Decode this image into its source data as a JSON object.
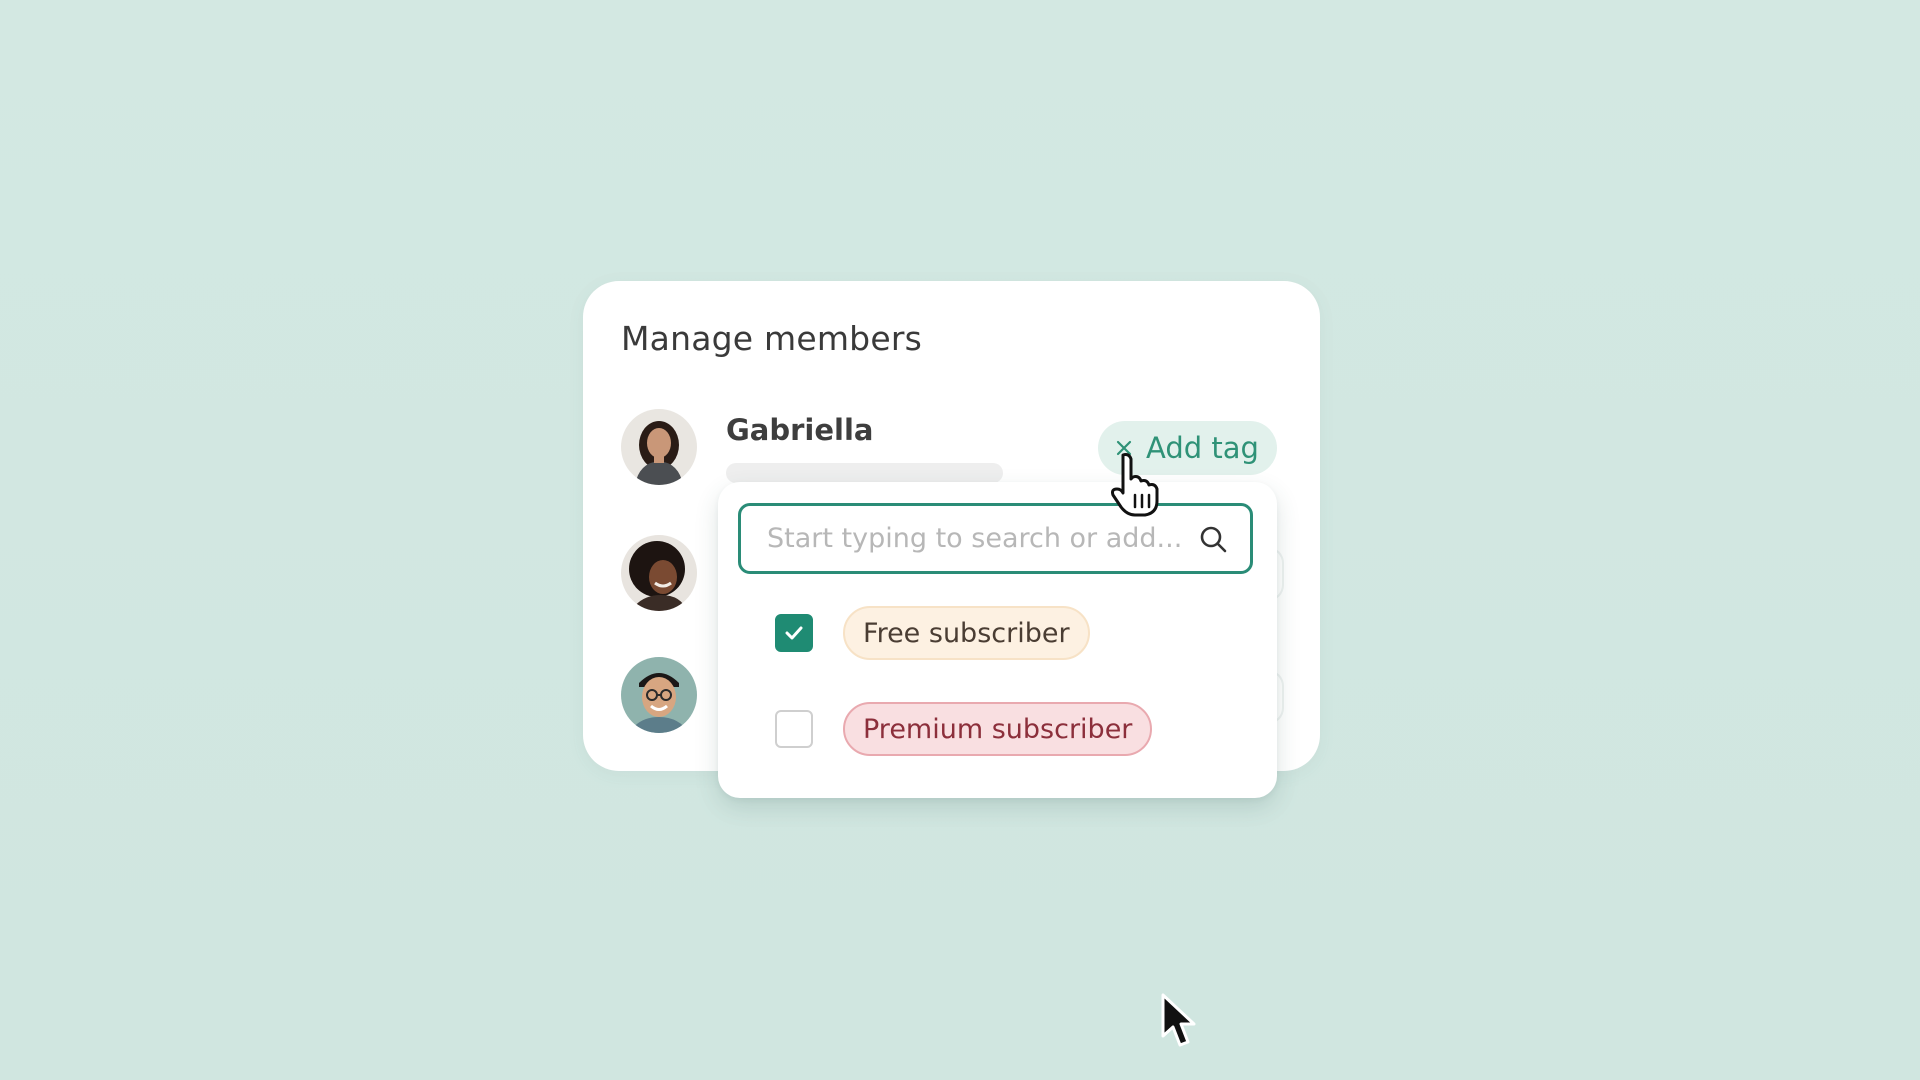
{
  "card": {
    "title": "Manage members"
  },
  "member": {
    "name": "Gabriella"
  },
  "add_tag": {
    "label": "Add tag",
    "icon": "close-icon"
  },
  "search": {
    "placeholder": "Start typing to search or add...",
    "value": "",
    "icon": "search-icon"
  },
  "tags": [
    {
      "label": "Free subscriber",
      "checked": true
    },
    {
      "label": "Premium subscriber",
      "checked": false
    }
  ],
  "colors": {
    "background": "#d1e7e1",
    "accent": "#2a8c77",
    "checkbox_checked": "#1f8b73",
    "free_tag_bg": "#fdf1e2",
    "premium_tag_bg": "#f9dfe1",
    "premium_tag_text": "#8c2f3b"
  }
}
